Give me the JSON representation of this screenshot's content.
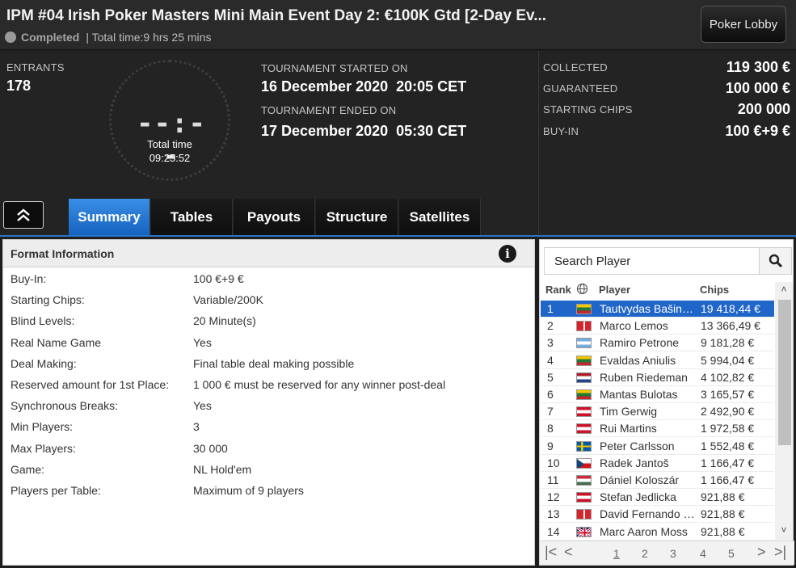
{
  "header": {
    "title": "IPM #04 Irish Poker Masters Mini Main Event Day 2: €100K Gtd [2-Day Ev...",
    "status": "Completed",
    "total_time_text": "| Total time:9 hrs  25 mins",
    "lobby_button": "Poker Lobby"
  },
  "info": {
    "entrants_label": "ENTRANTS",
    "entrants_value": "178",
    "clock_digits": "--:--",
    "clock_label": "Total time",
    "clock_value": "09:25:52",
    "started_label": "TOURNAMENT STARTED ON",
    "started_value": "16 December 2020  20:05 CET",
    "ended_label": "TOURNAMENT ENDED ON",
    "ended_value": "17 December 2020  05:30 CET"
  },
  "prize": [
    {
      "label": "COLLECTED",
      "value": "119 300 €"
    },
    {
      "label": "GUARANTEED",
      "value": "100 000 €"
    },
    {
      "label": "STARTING CHIPS",
      "value": "200 000"
    },
    {
      "label": "BUY-IN",
      "value": "100 €+9 €"
    }
  ],
  "tabs": [
    "Summary",
    "Tables",
    "Payouts",
    "Structure",
    "Satellites"
  ],
  "format": {
    "heading": "Format Information",
    "info_glyph": "i",
    "rows": [
      {
        "k": "Buy-In:",
        "v": "100 €+9 €"
      },
      {
        "k": "Starting Chips:",
        "v": "Variable/200K"
      },
      {
        "k": "Blind Levels:",
        "v": "20 Minute(s)"
      },
      {
        "k": "Real Name Game",
        "v": "Yes"
      },
      {
        "k": "Deal Making:",
        "v": "Final table deal making possible"
      },
      {
        "k": "Reserved amount for 1st Place:",
        "v": "1 000 € must be reserved for any winner post-deal"
      },
      {
        "k": "Synchronous Breaks:",
        "v": "Yes"
      },
      {
        "k": "Min Players:",
        "v": "3"
      },
      {
        "k": "Max Players:",
        "v": "30 000"
      },
      {
        "k": "Game:",
        "v": "NL Hold'em"
      },
      {
        "k": "Players per Table:",
        "v": "Maximum of 9 players"
      }
    ]
  },
  "players": {
    "search_placeholder": "Search Player",
    "col_rank": "Rank",
    "col_player": "Player",
    "col_chips": "Chips",
    "rows": [
      {
        "rank": "1",
        "name": "Tautvydas Bašinskas",
        "chips": "19 418,44 €",
        "flag": "lt"
      },
      {
        "rank": "2",
        "name": "Marco Lemos",
        "chips": "13 366,49 €",
        "flag": "pt"
      },
      {
        "rank": "3",
        "name": "Ramiro Petrone",
        "chips": "9 181,28 €",
        "flag": "ar"
      },
      {
        "rank": "4",
        "name": "Evaldas Aniulis",
        "chips": "5 994,04 €",
        "flag": "lt"
      },
      {
        "rank": "5",
        "name": "Ruben Riedeman",
        "chips": "4 102,82 €",
        "flag": "nl"
      },
      {
        "rank": "6",
        "name": "Mantas Bulotas",
        "chips": "3 165,57 €",
        "flag": "lt"
      },
      {
        "rank": "7",
        "name": "Tim Gerwig",
        "chips": "2 492,90 €",
        "flag": "at"
      },
      {
        "rank": "8",
        "name": "Rui Martins",
        "chips": "1 972,58 €",
        "flag": "at"
      },
      {
        "rank": "9",
        "name": "Peter Carlsson",
        "chips": "1 552,48 €",
        "flag": "se"
      },
      {
        "rank": "10",
        "name": "Radek Jantoš",
        "chips": "1 166,47 €",
        "flag": "cz"
      },
      {
        "rank": "11",
        "name": "Dániel Koloszár",
        "chips": "1 166,47 €",
        "flag": "hu"
      },
      {
        "rank": "12",
        "name": "Stefan Jedlicka",
        "chips": "921,88 €",
        "flag": "at"
      },
      {
        "rank": "13",
        "name": "David Fernando Rod",
        "chips": "921,88 €",
        "flag": "pt"
      },
      {
        "rank": "14",
        "name": "Marc Aaron Moss",
        "chips": "921,88 €",
        "flag": "gb"
      }
    ],
    "pager": [
      "|<",
      "<",
      "1",
      "2",
      "3",
      "4",
      "5",
      ">",
      ">|"
    ]
  }
}
